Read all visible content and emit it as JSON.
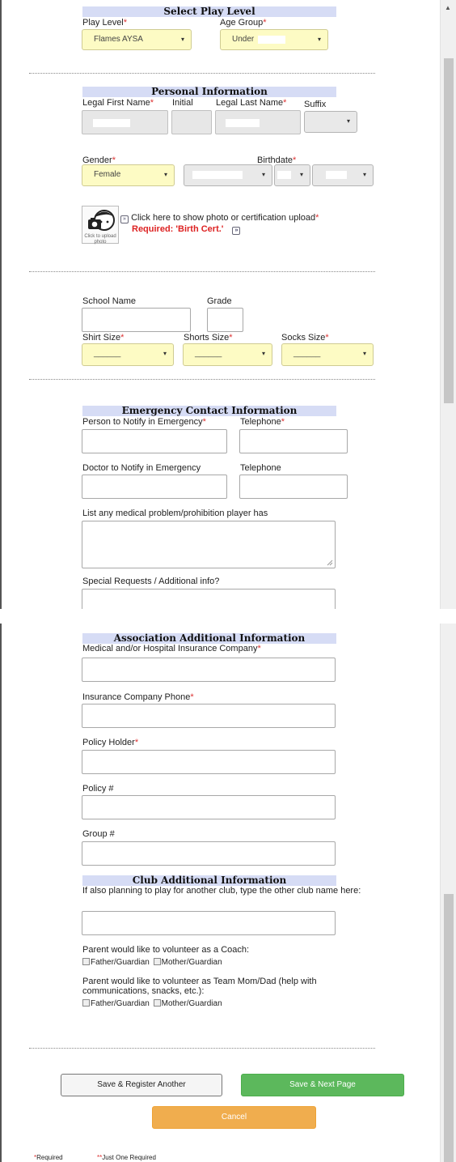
{
  "play": {
    "header": "Select Play Level",
    "level_label": "Play Level",
    "level_value": "Flames AYSA",
    "age_label": "Age Group",
    "age_value": "Under"
  },
  "personal": {
    "header": "Personal Information",
    "first_label": "Legal First Name",
    "initial_label": "Initial",
    "last_label": "Legal Last Name",
    "suffix_label": "Suffix",
    "gender_label": "Gender",
    "gender_value": "Female",
    "birthdate_label": "Birthdate",
    "photo_caption": "Click to upload photo",
    "upload_text": "Click here to show photo or certification upload",
    "required_text": "Required:  'Birth Cert.'"
  },
  "school": {
    "name_label": "School Name",
    "grade_label": "Grade",
    "shirt_label": "Shirt Size",
    "shorts_label": "Shorts Size",
    "socks_label": "Socks Size",
    "blank_option": "______"
  },
  "emergency": {
    "header": "Emergency Contact Information",
    "person_label": "Person to Notify in Emergency",
    "tel_label": "Telephone",
    "doctor_label": "Doctor to Notify in Emergency",
    "doctor_tel_label": "Telephone",
    "medical_label": "List any medical problem/prohibition player has",
    "special_label": "Special Requests / Additional info?"
  },
  "association": {
    "header": "Association Additional Information",
    "insurance_label": "Medical and/or Hospital Insurance Company",
    "phone_label": "Insurance Company Phone",
    "holder_label": "Policy Holder",
    "policy_label": "Policy #",
    "group_label": "Group #"
  },
  "club": {
    "header": "Club Additional Information",
    "other_club_label": "If also planning to play for another club, type the other club name here:",
    "coach_label": "Parent would like to volunteer as a Coach:",
    "father": "Father/Guardian",
    "mother": "Mother/Guardian",
    "teammom_label": "Parent would like to volunteer as Team Mom/Dad (help with communications, snacks, etc.):"
  },
  "buttons": {
    "save_another": "Save & Register Another",
    "save_next": "Save & Next Page",
    "cancel": "Cancel"
  },
  "legend": {
    "star": "*",
    "required": "Required",
    "double_star": "**",
    "just_one": "Just One Required"
  },
  "marks": {
    "required_star": "*",
    "dropdown_caret": "▾",
    "expand_glyph": "»"
  },
  "colors": {
    "header_bg": "#d6dcf5",
    "required_red": "#dd3333",
    "select_yellow": "#fdfbc4",
    "green": "#5cb85c",
    "orange": "#f0ad4e"
  },
  "icons": [
    "camera-user-icon",
    "expand-icon",
    "dropdown-caret-icon",
    "scroll-up-arrow-icon"
  ]
}
